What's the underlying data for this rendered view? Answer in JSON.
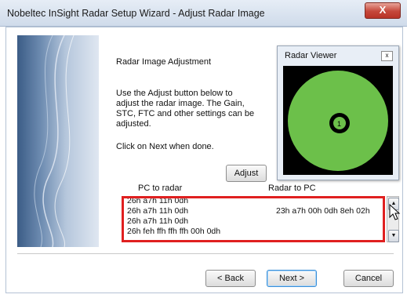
{
  "window": {
    "title": "Nobeltec InSight Radar Setup Wizard - Adjust Radar Image",
    "close_label": "X"
  },
  "content": {
    "heading": "Radar Image Adjustment",
    "description": [
      "Use the Adjust button below to",
      "adjust the radar image. The Gain,",
      "STC, FTC and other settings can be",
      "adjusted."
    ],
    "next_note": "Click on Next when done.",
    "adjust_label": "Adjust"
  },
  "radar_viewer": {
    "title": "Radar Viewer",
    "close_label": "x",
    "blip_label": "1"
  },
  "log": {
    "pc_to_radar_label": "PC to radar",
    "radar_to_pc_label": "Radar to PC",
    "pc_to_radar_lines": [
      "26h a7h 11h 0dh",
      "26h a7h 11h 0dh",
      "26h a7h 11h 0dh",
      "26h feh ffh ffh ffh 00h 0dh"
    ],
    "radar_to_pc_lines": [
      "",
      "23h a7h 00h 0dh 8eh 02h",
      "",
      ""
    ]
  },
  "buttons": {
    "back": "< Back",
    "next": "Next >",
    "cancel": "Cancel"
  },
  "colors": {
    "radar_green": "#6cc04a",
    "highlight_red": "#e02020",
    "title_bar": "#dbe4f0"
  },
  "icons": {
    "scroll_up": "up-arrow-icon",
    "scroll_down": "down-arrow-icon",
    "cursor": "mouse-pointer-icon"
  }
}
